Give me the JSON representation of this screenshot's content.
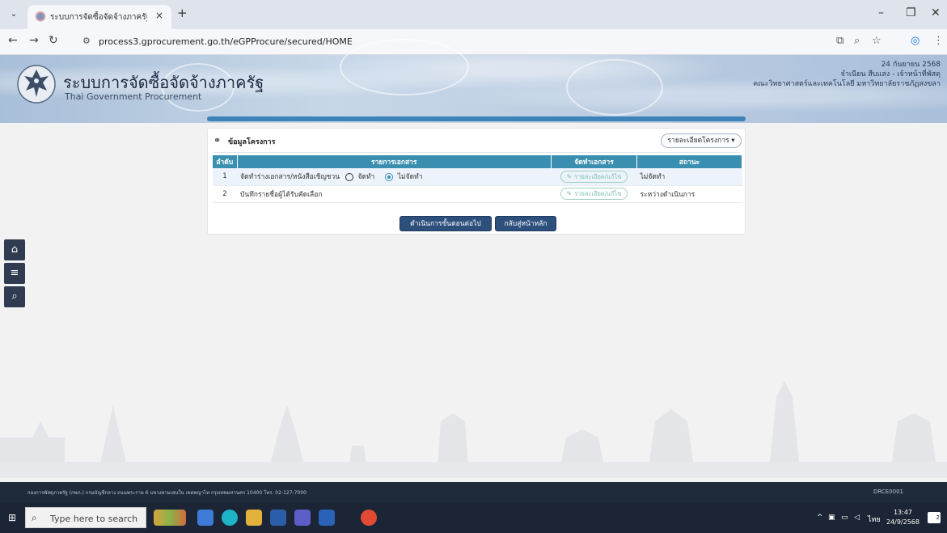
{
  "browser": {
    "tab_title": "ระบบการจัดซื้อจัดจ้างภาครัฐ",
    "tab_close": "×",
    "new_tab": "+",
    "url": "process3.gprocurement.go.th/eGPProcure/secured/HOME",
    "window_controls": {
      "minimize": "–",
      "maximize": "❐",
      "close": "✕"
    }
  },
  "banner": {
    "title": "ระบบการจัดซื้อจัดจ้างภาครัฐ",
    "subtitle": "Thai Government Procurement",
    "date": "24 กันยายน 2568",
    "user": "จำเนียน สืบแสง - เจ้าหน้าที่พัสดุ",
    "org": "คณะวิทยาศาสตร์และเทคโนโลยี มหาวิทยาลัยราชภัฏสงขลา"
  },
  "sidebar": {
    "icons": [
      "home-icon",
      "menu-icon",
      "search-icon"
    ]
  },
  "panel": {
    "title": "ข้อมูลโครงการ",
    "details_dropdown": "รายละเอียดโครงการ ▾",
    "columns": [
      "ลำดับ",
      "รายการเอกสาร",
      "จัดทำเอกสาร",
      "สถานะ"
    ],
    "rows": [
      {
        "num": "1",
        "doc": "จัดทำร่างเอกสาร/หนังสือเชิญชวน",
        "opt_make": "จัดทำ",
        "opt_skip": "ไม่จัดทำ",
        "action": "รายละเอียด/แก้ไข",
        "status": "ไม่จัดทำ"
      },
      {
        "num": "2",
        "doc": "บันทึกรายชื่อผู้ได้รับคัดเลือก",
        "action": "รายละเอียด/แก้ไข",
        "status": "ระหว่างดำเนินการ"
      }
    ],
    "btn_next": "ดำเนินการขั้นตอนต่อไป",
    "btn_home": "กลับสู่หน้าหลัก"
  },
  "footer": {
    "address": "กองการพัสดุภาครัฐ (กพภ.) กรมบัญชีกลาง ถนนพระราม 6 แขวงสามเสนใน เขตพญาไท กรุงเทพมหานคร 10400 โทร. 02-127-7000",
    "page_code": "DRCE0001"
  },
  "taskbar": {
    "search_placeholder": "Type here to search",
    "lang": "ไทย",
    "time": "13:47",
    "date": "24/9/2568",
    "notif_count": "2"
  }
}
